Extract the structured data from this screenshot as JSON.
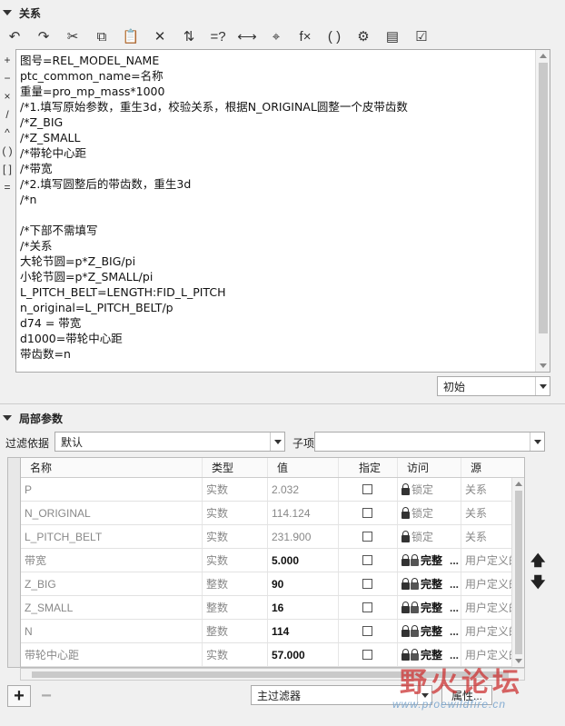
{
  "relations_section": {
    "title": "关系"
  },
  "toolbar": {
    "buttons": [
      {
        "name": "undo-icon",
        "glyph": "↶"
      },
      {
        "name": "redo-icon",
        "glyph": "↷"
      },
      {
        "name": "cut-icon",
        "glyph": "✂"
      },
      {
        "name": "copy-icon",
        "glyph": "⧉"
      },
      {
        "name": "paste-icon",
        "glyph": "📋"
      },
      {
        "name": "delete-icon",
        "glyph": "✕"
      },
      {
        "name": "sort-icon",
        "glyph": "⇅"
      },
      {
        "name": "evaluate-icon",
        "glyph": "=?"
      },
      {
        "name": "dimension-icon",
        "glyph": "⟷"
      },
      {
        "name": "measure-icon",
        "glyph": "⌖"
      },
      {
        "name": "function-icon",
        "glyph": "f×"
      },
      {
        "name": "bracket-icon",
        "glyph": "( )"
      },
      {
        "name": "settings-icon",
        "glyph": "⚙"
      },
      {
        "name": "show-dimensions-icon",
        "glyph": "▤"
      },
      {
        "name": "verify-icon",
        "glyph": "☑"
      }
    ]
  },
  "operators": [
    "+",
    "−",
    "×",
    "/",
    "^",
    "( )",
    "[ ]",
    "="
  ],
  "editor": {
    "lines": [
      "图号=REL_MODEL_NAME",
      "ptc_common_name=名称",
      "重量=pro_mp_mass*1000",
      "/*1.填写原始参数，重生3d，校验关系，根据N_ORIGINAL圆整一个皮带齿数",
      "/*Z_BIG",
      "/*Z_SMALL",
      "/*带轮中心距",
      "/*带宽",
      "/*2.填写圆整后的带齿数，重生3d",
      "/*n",
      "",
      "/*下部不需填写",
      "/*关系",
      "大轮节圆=p*Z_BIG/pi",
      "小轮节圆=p*Z_SMALL/pi",
      "L_PITCH_BELT=LENGTH:FID_L_PITCH",
      "n_original=L_PITCH_BELT/p",
      "d74 = 带宽",
      "d1000=带轮中心距",
      "带齿数=n"
    ]
  },
  "initial_select": {
    "value": "初始"
  },
  "local_params_section": {
    "title": "局部参数"
  },
  "filter": {
    "label": "过滤依据",
    "value": "默认",
    "subitem_label": "子项",
    "subitem_value": ""
  },
  "table": {
    "headers": [
      "名称",
      "类型",
      "值",
      "指定",
      "访问",
      "源"
    ],
    "rows": [
      {
        "name": "P",
        "type": "实数",
        "value": "2.032",
        "access": "锁定",
        "source": "关系",
        "locked": true
      },
      {
        "name": "N_ORIGINAL",
        "type": "实数",
        "value": "114.124",
        "access": "锁定",
        "source": "关系",
        "locked": true
      },
      {
        "name": "L_PITCH_BELT",
        "type": "实数",
        "value": "231.900",
        "access": "锁定",
        "source": "关系",
        "locked": true
      },
      {
        "name": "带宽",
        "type": "实数",
        "value": "5.000",
        "access": "完整",
        "source": "用户定义的",
        "locked": false
      },
      {
        "name": "Z_BIG",
        "type": "整数",
        "value": "90",
        "access": "完整",
        "source": "用户定义的",
        "locked": false
      },
      {
        "name": "Z_SMALL",
        "type": "整数",
        "value": "16",
        "access": "完整",
        "source": "用户定义的",
        "locked": false
      },
      {
        "name": "N",
        "type": "整数",
        "value": "114",
        "access": "完整",
        "source": "用户定义的",
        "locked": false
      },
      {
        "name": "带轮中心距",
        "type": "实数",
        "value": "57.000",
        "access": "完整",
        "source": "用户定义的",
        "locked": false
      }
    ]
  },
  "bottom": {
    "add": "+",
    "remove": "−",
    "main_filter": "主过滤器",
    "properties": "属性..."
  },
  "watermark": {
    "text": "野火论坛",
    "url": "www.proewildfire.cn"
  }
}
